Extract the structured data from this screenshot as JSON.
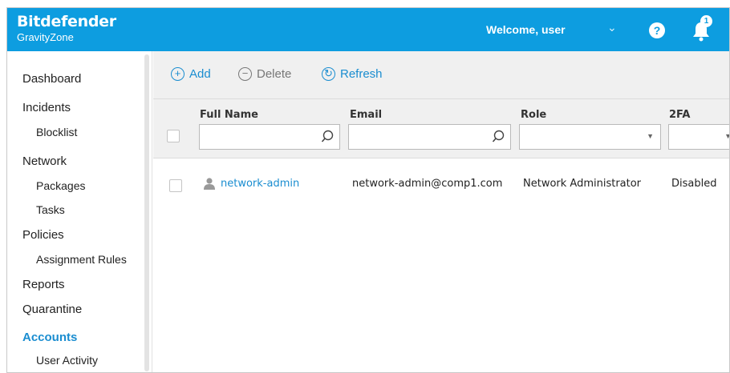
{
  "header": {
    "brand_name": "Bitdefender",
    "brand_sub": "GravityZone",
    "welcome": "Welcome, user",
    "help_symbol": "?",
    "notification_count": "1",
    "accent_color": "#0d9de0"
  },
  "sidebar": {
    "items": [
      {
        "label": "Dashboard"
      },
      {
        "label": "Incidents"
      },
      {
        "label": "Blocklist"
      },
      {
        "label": "Network"
      },
      {
        "label": "Packages"
      },
      {
        "label": "Tasks"
      },
      {
        "label": "Policies"
      },
      {
        "label": "Assignment Rules"
      },
      {
        "label": "Reports"
      },
      {
        "label": "Quarantine"
      },
      {
        "label": "Accounts"
      },
      {
        "label": "User Activity"
      }
    ],
    "active": "Accounts"
  },
  "toolbar": {
    "add_label": "Add",
    "delete_label": "Delete",
    "refresh_label": "Refresh"
  },
  "table": {
    "columns": [
      {
        "title": "Full Name",
        "filter": "text"
      },
      {
        "title": "Email",
        "filter": "text"
      },
      {
        "title": "Role",
        "filter": "select"
      },
      {
        "title": "2FA",
        "filter": "select"
      }
    ],
    "rows": [
      {
        "full_name": "network-admin",
        "email": "network-admin@comp1.com",
        "role": "Network Administrator",
        "twofa": "Disabled"
      }
    ]
  }
}
